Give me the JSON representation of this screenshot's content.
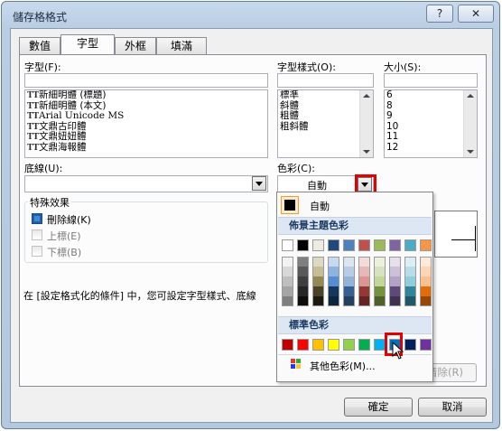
{
  "window": {
    "title": "儲存格格式",
    "help_label": "?",
    "close_label": "✕"
  },
  "tabs": [
    {
      "label": "數值"
    },
    {
      "label": "字型"
    },
    {
      "label": "外框"
    },
    {
      "label": "填滿"
    }
  ],
  "font": {
    "label": "字型(F):",
    "value": "",
    "items": [
      {
        "icon": "TT",
        "label": "新細明體 (標題)"
      },
      {
        "icon": "TT",
        "label": "新細明體 (本文)"
      },
      {
        "icon": "TT",
        "label": "Arial Unicode MS"
      },
      {
        "icon": "TT",
        "label": "文鼎古印體"
      },
      {
        "icon": "TT",
        "label": "文鼎妞妞體"
      },
      {
        "icon": "TT",
        "label": "文鼎海報體"
      }
    ]
  },
  "style": {
    "label": "字型樣式(O):",
    "value": "",
    "items": [
      "標準",
      "斜體",
      "粗體",
      "粗斜體"
    ]
  },
  "size": {
    "label": "大小(S):",
    "value": "",
    "items": [
      "6",
      "8",
      "9",
      "10",
      "11",
      "12"
    ]
  },
  "underline": {
    "label": "底線(U):",
    "value": ""
  },
  "color": {
    "label": "色彩(C):",
    "value": "自動"
  },
  "effects": {
    "group_label": "特殊效果",
    "strikethrough": "刪除線(K)",
    "superscript": "上標(E)",
    "subscript": "下標(B)"
  },
  "info_text": "在 [設定格式化的條件] 中，您可設定字型樣式、底線",
  "color_panel": {
    "automatic_label": "自動",
    "theme_header": "佈景主題色彩",
    "standard_header": "標準色彩",
    "more_colors_label": "其他色彩(M)...",
    "theme_top": [
      "#FFFFFF",
      "#000000",
      "#EEECE1",
      "#1F497D",
      "#4F81BD",
      "#C0504D",
      "#9BBB59",
      "#8064A2",
      "#4BACC6",
      "#F79646"
    ],
    "theme_shades": [
      [
        "#F2F2F2",
        "#D8D8D8",
        "#BFBFBF",
        "#A5A5A5",
        "#7F7F7F"
      ],
      [
        "#7F7F7F",
        "#595959",
        "#3F3F3F",
        "#262626",
        "#0C0C0C"
      ],
      [
        "#DDD9C3",
        "#C4BD97",
        "#938953",
        "#494429",
        "#1D1B10"
      ],
      [
        "#C6D9F0",
        "#8DB3E2",
        "#548DD4",
        "#17365D",
        "#0F243E"
      ],
      [
        "#DBE5F1",
        "#B8CCE4",
        "#95B3D7",
        "#366092",
        "#244061"
      ],
      [
        "#F2DCDB",
        "#E5B9B7",
        "#D99694",
        "#953734",
        "#632423"
      ],
      [
        "#EBF1DD",
        "#D7E3BC",
        "#C3D69B",
        "#76923C",
        "#4F6128"
      ],
      [
        "#E5E0EC",
        "#CCC1D9",
        "#B2A2C7",
        "#5F497A",
        "#3F3151"
      ],
      [
        "#DBEEF3",
        "#B7DDE8",
        "#92CDDC",
        "#31859B",
        "#205867"
      ],
      [
        "#FDEADA",
        "#FBD5B5",
        "#FAC08F",
        "#E36C09",
        "#974806"
      ]
    ],
    "standard": [
      "#C00000",
      "#FF0000",
      "#FFC000",
      "#FFFF00",
      "#92D050",
      "#00B050",
      "#00B0F0",
      "#0070C0",
      "#002060",
      "#7030A0"
    ]
  },
  "buttons": {
    "clear_label": "清除(R)",
    "ok_label": "確定",
    "cancel_label": "取消"
  }
}
